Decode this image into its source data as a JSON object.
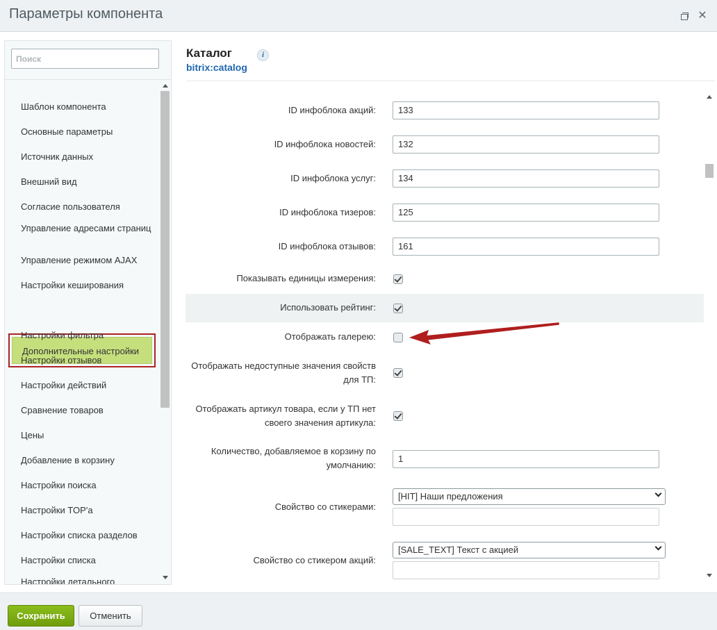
{
  "window": {
    "title": "Параметры компонента",
    "restore_icon": "restore-window-icon",
    "close_glyph": "✕"
  },
  "sidebar": {
    "search_placeholder": "Поиск",
    "items": [
      {
        "label": "Шаблон компонента"
      },
      {
        "label": "Основные параметры"
      },
      {
        "label": "Источник данных"
      },
      {
        "label": "Внешний вид"
      },
      {
        "label": "Согласие пользователя"
      },
      {
        "label": "Управление адресами страниц"
      },
      {
        "label": "Управление режимом AJAX"
      },
      {
        "label": "Настройки кеширования"
      },
      {
        "label": "Дополнительные настройки",
        "active": true
      },
      {
        "label": "Настройки фильтра"
      },
      {
        "label": "Настройки отзывов"
      },
      {
        "label": "Настройки действий"
      },
      {
        "label": "Сравнение товаров"
      },
      {
        "label": "Цены"
      },
      {
        "label": "Добавление в корзину"
      },
      {
        "label": "Настройки поиска"
      },
      {
        "label": "Настройки TOP'а"
      },
      {
        "label": "Настройки списка разделов"
      },
      {
        "label": "Настройки списка"
      },
      {
        "label": "Настройки детального"
      }
    ]
  },
  "header": {
    "title": "Каталог",
    "subtitle": "bitrix:catalog",
    "info_glyph": "i"
  },
  "fields": {
    "promo_iblock": {
      "label": "ID инфоблока акций:",
      "value": "133"
    },
    "news_iblock": {
      "label": "ID инфоблока новостей:",
      "value": "132"
    },
    "services_iblock": {
      "label": "ID инфоблока услуг:",
      "value": "134"
    },
    "teasers_iblock": {
      "label": "ID инфоблока тизеров:",
      "value": "125"
    },
    "reviews_iblock": {
      "label": "ID инфоблока отзывов:",
      "value": "161"
    },
    "show_units": {
      "label": "Показывать единицы измерения:",
      "checked": true
    },
    "use_rating": {
      "label": "Использовать рейтинг:",
      "checked": true
    },
    "show_gallery": {
      "label": "Отображать галерею:",
      "checked": false
    },
    "show_unavailable": {
      "label_line1": "Отображать недоступные значения свойств",
      "label_line2": "для ТП:",
      "checked": true
    },
    "show_article": {
      "label_line1": "Отображать артикул товара, если у ТП нет",
      "label_line2": "своего значения артикула:",
      "checked": true
    },
    "basket_qty": {
      "label_line1": "Количество, добавляемое в корзину по",
      "label_line2": "умолчанию:",
      "value": "1"
    },
    "stickers_prop": {
      "label": "Свойство со стикерами:",
      "selected": "[HIT] Наши предложения"
    },
    "promo_sticker_prop": {
      "label": "Свойство со стикером акций:",
      "selected": "[SALE_TEXT] Текст с акцией"
    }
  },
  "footer": {
    "save_label": "Сохранить",
    "cancel_label": "Отменить"
  },
  "colors": {
    "active_item_bg": "#c5df7d",
    "highlight_border": "#ac2224",
    "save_button": "#7aab12",
    "link_blue": "#2067b0",
    "annotation_arrow": "#b01e1e"
  }
}
